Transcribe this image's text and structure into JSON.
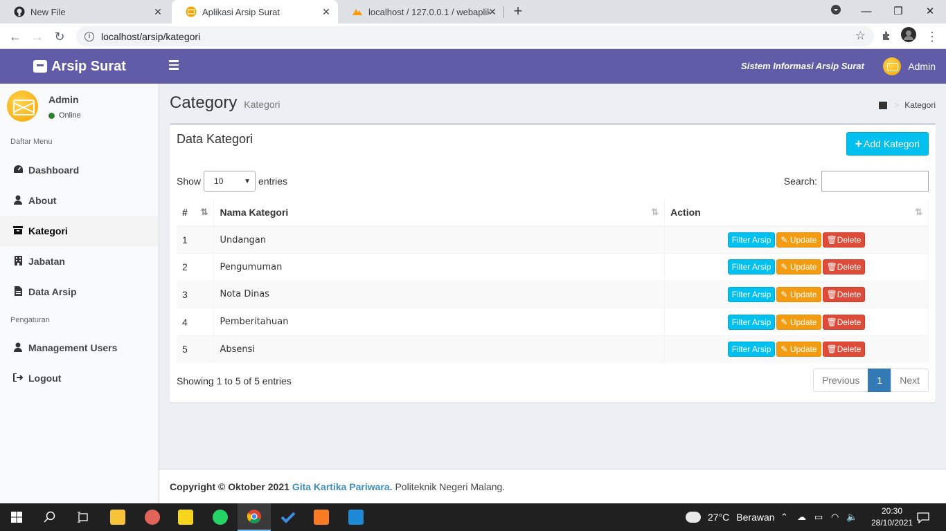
{
  "browser": {
    "tabs": [
      {
        "title": "New File",
        "icon": "github-icon"
      },
      {
        "title": "Aplikasi Arsip Surat",
        "icon": "mail-logo-icon"
      },
      {
        "title": "localhost / 127.0.0.1 / webaplikas",
        "icon": "phpmyadmin-icon"
      }
    ],
    "url": "localhost/arsip/kategori"
  },
  "header": {
    "logo": "Arsip Surat",
    "system_name": "Sistem Informasi Arsip Surat",
    "user": "Admin",
    "color": "#605ca8"
  },
  "sidebar": {
    "user_name": "Admin",
    "status": "Online",
    "section1": "Daftar Menu",
    "section2": "Pengaturan",
    "items": [
      {
        "label": "Dashboard",
        "icon": "dashboard-icon"
      },
      {
        "label": "About",
        "icon": "user-icon"
      },
      {
        "label": "Kategori",
        "icon": "archive-icon"
      },
      {
        "label": "Jabatan",
        "icon": "building-icon"
      },
      {
        "label": "Data Arsip",
        "icon": "file-icon"
      },
      {
        "label": "Management Users",
        "icon": "user-icon"
      },
      {
        "label": "Logout",
        "icon": "sign-out-icon"
      }
    ]
  },
  "content": {
    "title": "Category",
    "subtitle": "Kategori",
    "breadcrumb": "Kategori",
    "box_title": "Data Kategori",
    "add_button": "Add Kategori",
    "show_label": "Show",
    "entries_label": "entries",
    "page_length": "10",
    "search_label": "Search:",
    "columns": [
      "#",
      "Nama Kategori",
      "Action"
    ],
    "rows": [
      {
        "no": "1",
        "name": "Undangan"
      },
      {
        "no": "2",
        "name": "Pengumuman"
      },
      {
        "no": "3",
        "name": "Nota Dinas"
      },
      {
        "no": "4",
        "name": "Pemberitahuan"
      },
      {
        "no": "5",
        "name": "Absensi"
      }
    ],
    "actions": {
      "filter": "Filter Arsip",
      "update": "Update",
      "delete": "Delete"
    },
    "info": "Showing 1 to 5 of 5 entries",
    "pagination": {
      "previous": "Previous",
      "current": "1",
      "next": "Next"
    }
  },
  "footer": {
    "prefix": "Copyright © Oktober 2021",
    "link": "Gita Kartika Pariwara.",
    "suffix": "Politeknik Negeri Malang."
  },
  "taskbar": {
    "temperature": "27°C",
    "weather": "Berawan",
    "time": "20:30",
    "date": "28/10/2021"
  }
}
